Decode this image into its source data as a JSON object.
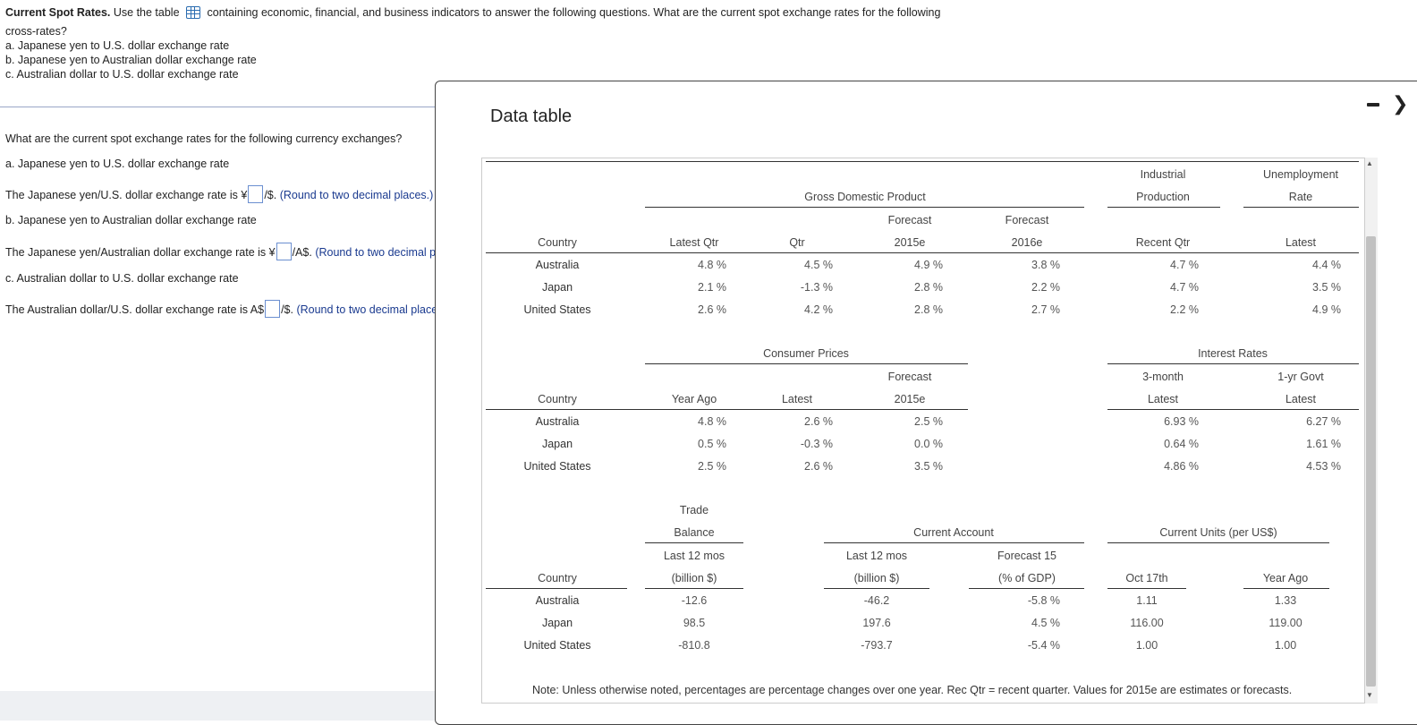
{
  "question": {
    "title": "Current Spot Rates.",
    "intro_pre": "Use the table",
    "intro_post": "containing economic, financial, and business indicators to answer the following questions. What are the current spot exchange rates for the following",
    "intro_line2": "cross-rates?",
    "items": [
      "a. Japanese yen to U.S. dollar exchange rate",
      "b. Japanese yen to Australian dollar exchange rate",
      "c. Australian dollar to U.S. dollar exchange rate"
    ]
  },
  "answers": {
    "prompt": "What are the current spot exchange rates for the following currency exchanges?",
    "a_label": "a. Japanese yen to U.S. dollar exchange rate",
    "a_pre": "The Japanese yen/U.S. dollar exchange rate is ¥",
    "a_post": "/$.",
    "a_hint": "(Round to two decimal places.)",
    "b_label": "b. Japanese yen to Australian dollar exchange rate",
    "b_pre": "The Japanese yen/Australian dollar exchange rate is ¥",
    "b_post": "/A$.",
    "b_hint": "(Round to two decimal places.)",
    "c_label": "c. Australian dollar to U.S. dollar exchange rate",
    "c_pre": "The Australian dollar/U.S. dollar exchange rate is A$",
    "c_post": "/$.",
    "c_hint": "(Round to two decimal places.)"
  },
  "modal": {
    "title": "Data table",
    "min_icon": "minimize-icon",
    "close_icon": "close-icon",
    "note": "Note: Unless otherwise noted, percentages are percentage changes over one year. Rec Qtr = recent quarter. Values for 2015e are estimates or forecasts."
  },
  "section1": {
    "group_gdp": "Gross Domestic Product",
    "group_ind1": "Industrial",
    "group_ind2": "Production",
    "group_unemp1": "Unemployment",
    "group_unemp2": "Rate",
    "h_forecast": "Forecast",
    "h_forecast2": "Forecast",
    "h_country": "Country",
    "h_latest_qtr": "Latest Qtr",
    "h_qtr": "Qtr",
    "h_2015e": "2015e",
    "h_2016e": "2016e",
    "h_recent_qtr": "Recent Qtr",
    "h_latest": "Latest",
    "rows": [
      {
        "country": "Australia",
        "latest_qtr": "4.8 %",
        "qtr": "4.5 %",
        "f2015": "4.9 %",
        "f2016": "3.8 %",
        "ind": "4.7 %",
        "unemp": "4.4 %"
      },
      {
        "country": "Japan",
        "latest_qtr": "2.1 %",
        "qtr": "-1.3 %",
        "f2015": "2.8 %",
        "f2016": "2.2 %",
        "ind": "4.7 %",
        "unemp": "3.5 %"
      },
      {
        "country": "United States",
        "latest_qtr": "2.6 %",
        "qtr": "4.2 %",
        "f2015": "2.8 %",
        "f2016": "2.7 %",
        "ind": "2.2 %",
        "unemp": "4.9 %"
      }
    ]
  },
  "section2": {
    "group_cp": "Consumer Prices",
    "group_ir": "Interest Rates",
    "h_forecast": "Forecast",
    "h_3month": "3-month",
    "h_1yr": "1-yr Govt",
    "h_country": "Country",
    "h_year_ago": "Year Ago",
    "h_latest": "Latest",
    "h_2015e": "2015e",
    "h_latest2": "Latest",
    "h_latest3": "Latest",
    "rows": [
      {
        "country": "Australia",
        "year_ago": "4.8 %",
        "latest": "2.6 %",
        "f2015": "2.5 %",
        "m3": "6.93 %",
        "y1": "6.27 %"
      },
      {
        "country": "Japan",
        "year_ago": "0.5 %",
        "latest": "-0.3 %",
        "f2015": "0.0 %",
        "m3": "0.64 %",
        "y1": "1.61 %"
      },
      {
        "country": "United States",
        "year_ago": "2.5 %",
        "latest": "2.6 %",
        "f2015": "3.5 %",
        "m3": "4.86 %",
        "y1": "4.53 %"
      }
    ]
  },
  "section3": {
    "h_trade1": "Trade",
    "h_trade2": "Balance",
    "group_ca": "Current Account",
    "group_cu": "Current Units (per US$)",
    "h_last12": "Last 12 mos",
    "h_billion": "(billion $)",
    "h_ca_last12": "Last 12 mos",
    "h_ca_billion": "(billion $)",
    "h_forecast15": "Forecast 15",
    "h_pct_gdp": "(% of GDP)",
    "h_country": "Country",
    "h_oct17": "Oct 17th",
    "h_year_ago": "Year Ago",
    "rows": [
      {
        "country": "Australia",
        "trade": "-12.6",
        "ca": "-46.2",
        "ca_f": "-5.8 %",
        "oct": "1.11",
        "ya": "1.33"
      },
      {
        "country": "Japan",
        "trade": "98.5",
        "ca": "197.6",
        "ca_f": "4.5 %",
        "oct": "116.00",
        "ya": "119.00"
      },
      {
        "country": "United States",
        "trade": "-810.8",
        "ca": "-793.7",
        "ca_f": "-5.4 %",
        "oct": "1.00",
        "ya": "1.00"
      }
    ]
  }
}
